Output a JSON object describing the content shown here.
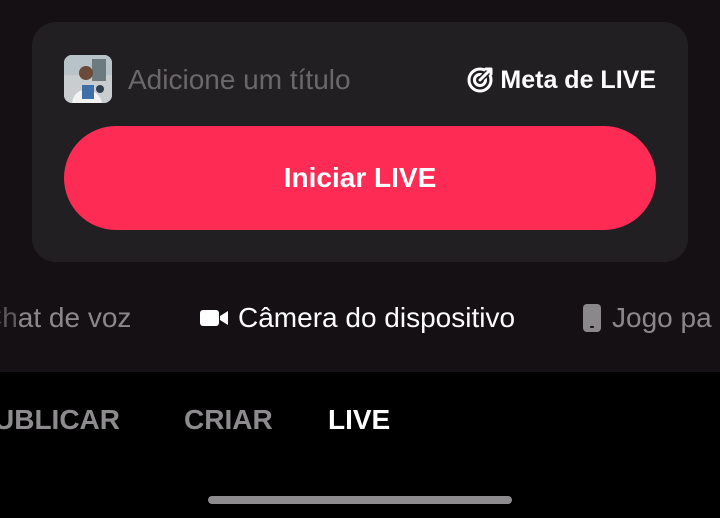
{
  "card": {
    "title_placeholder": "Adicione um título",
    "goal_label": "Meta de LIVE",
    "start_button_label": "Iniciar LIVE"
  },
  "modes": {
    "voice_label_prefix": "Ch",
    "voice_label": "at de voz",
    "camera_label": "Câmera do dispositivo",
    "game_label": "Jogo pa"
  },
  "tabs": {
    "publish": "UBLICAR",
    "create": "CRIAR",
    "live": "LIVE"
  },
  "icons": {
    "goal": "target-icon",
    "camera": "video-camera-icon",
    "game": "phone-icon",
    "avatar": "user-avatar"
  },
  "colors": {
    "accent": "#fe2c55",
    "card_bg": "#221f22",
    "bottom_bar_bg": "#000000"
  }
}
